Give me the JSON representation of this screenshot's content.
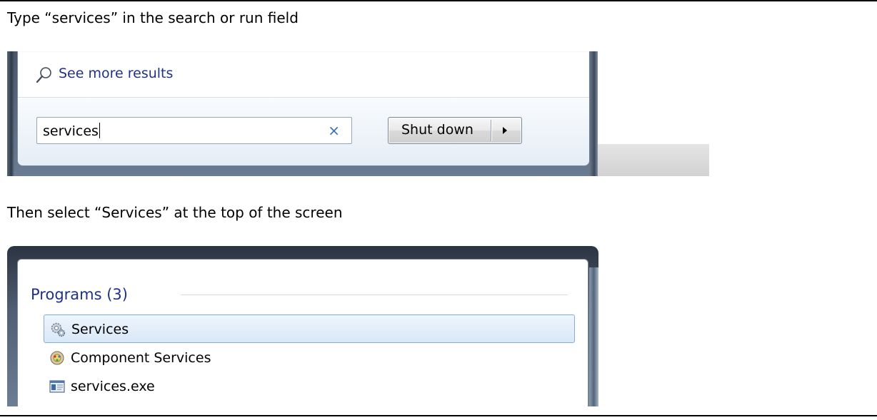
{
  "doc": {
    "step1_text": "Type “services” in the search or run field",
    "step2_text": "Then select “Services” at the top of the screen"
  },
  "start_menu": {
    "see_more_label": "See more results",
    "search_value": "services",
    "clear_glyph": "×",
    "shutdown_label": "Shut down",
    "icons": [
      "search-icon",
      "clear-icon",
      "arrow-right-icon"
    ]
  },
  "search_results": {
    "group_title": "Programs (3)",
    "items": [
      {
        "label": "Services",
        "icon": "gears-icon",
        "selected": true
      },
      {
        "label": "Component Services",
        "icon": "component-services-icon",
        "selected": false
      },
      {
        "label": "services.exe",
        "icon": "exe-window-icon",
        "selected": false
      }
    ],
    "accent_color": "#1e3287",
    "selection_color": "#84acdd"
  }
}
